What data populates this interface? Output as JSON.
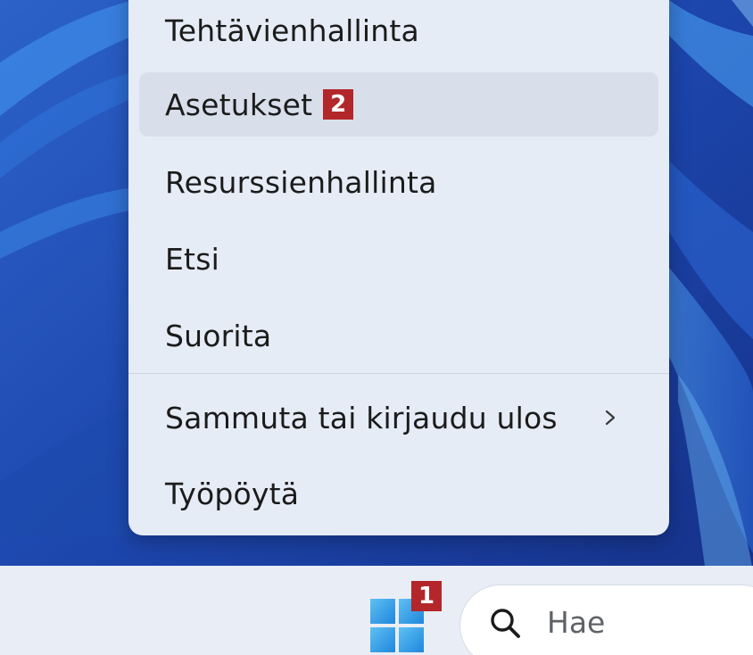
{
  "menu": {
    "items": [
      {
        "label": "Tehtävienhallinta"
      },
      {
        "label": "Asetukset",
        "badge": "2",
        "highlighted": true
      },
      {
        "label": "Resurssienhallinta"
      },
      {
        "label": "Etsi"
      },
      {
        "label": "Suorita"
      },
      {
        "label": "Sammuta tai kirjaudu ulos",
        "has_submenu": true
      },
      {
        "label": "Työpöytä"
      }
    ]
  },
  "taskbar": {
    "start_badge": "1",
    "start_icon": "windows-start-icon",
    "search": {
      "placeholder": "Hae",
      "icon": "search-icon"
    }
  },
  "colors": {
    "badge": "#b3272a",
    "menu_background": "#e6ecf6",
    "menu_highlight": "#d8dfeb",
    "wallpaper": "#1e49b0",
    "start_icon": "#3aa6e8"
  }
}
